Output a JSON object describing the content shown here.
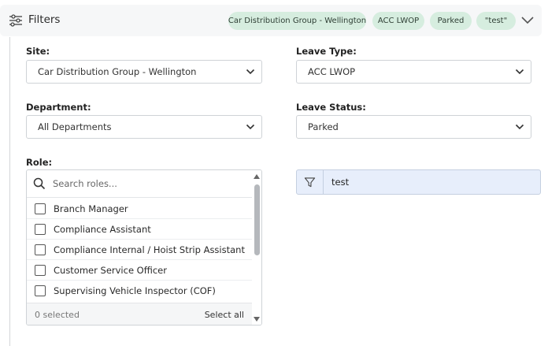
{
  "header": {
    "title": "Filters",
    "icon": "sliders-icon",
    "chips": [
      "Car Distribution Group - Wellington",
      "ACC LWOP",
      "Parked",
      "\"test\""
    ],
    "chip_color": "#d6eddf",
    "collapse_icon": "chevron-down-icon"
  },
  "site": {
    "label": "Site:",
    "value": "Car Distribution Group - Wellington"
  },
  "leave_type": {
    "label": "Leave Type:",
    "value": "ACC LWOP"
  },
  "department": {
    "label": "Department:",
    "value": "All Departments"
  },
  "leave_status": {
    "label": "Leave Status:",
    "value": "Parked"
  },
  "role": {
    "label": "Role:",
    "search_placeholder": "Search roles...",
    "items": [
      "Branch Manager",
      "Compliance Assistant",
      "Compliance Internal / Hoist Strip Assistant",
      "Customer Service Officer",
      "Supervising Vehicle Inspector (COF)"
    ],
    "selected_count": "0 selected",
    "select_all": "Select all"
  },
  "text_filter": {
    "value": "test",
    "icon": "filter-icon",
    "background": "#e7eefb"
  }
}
